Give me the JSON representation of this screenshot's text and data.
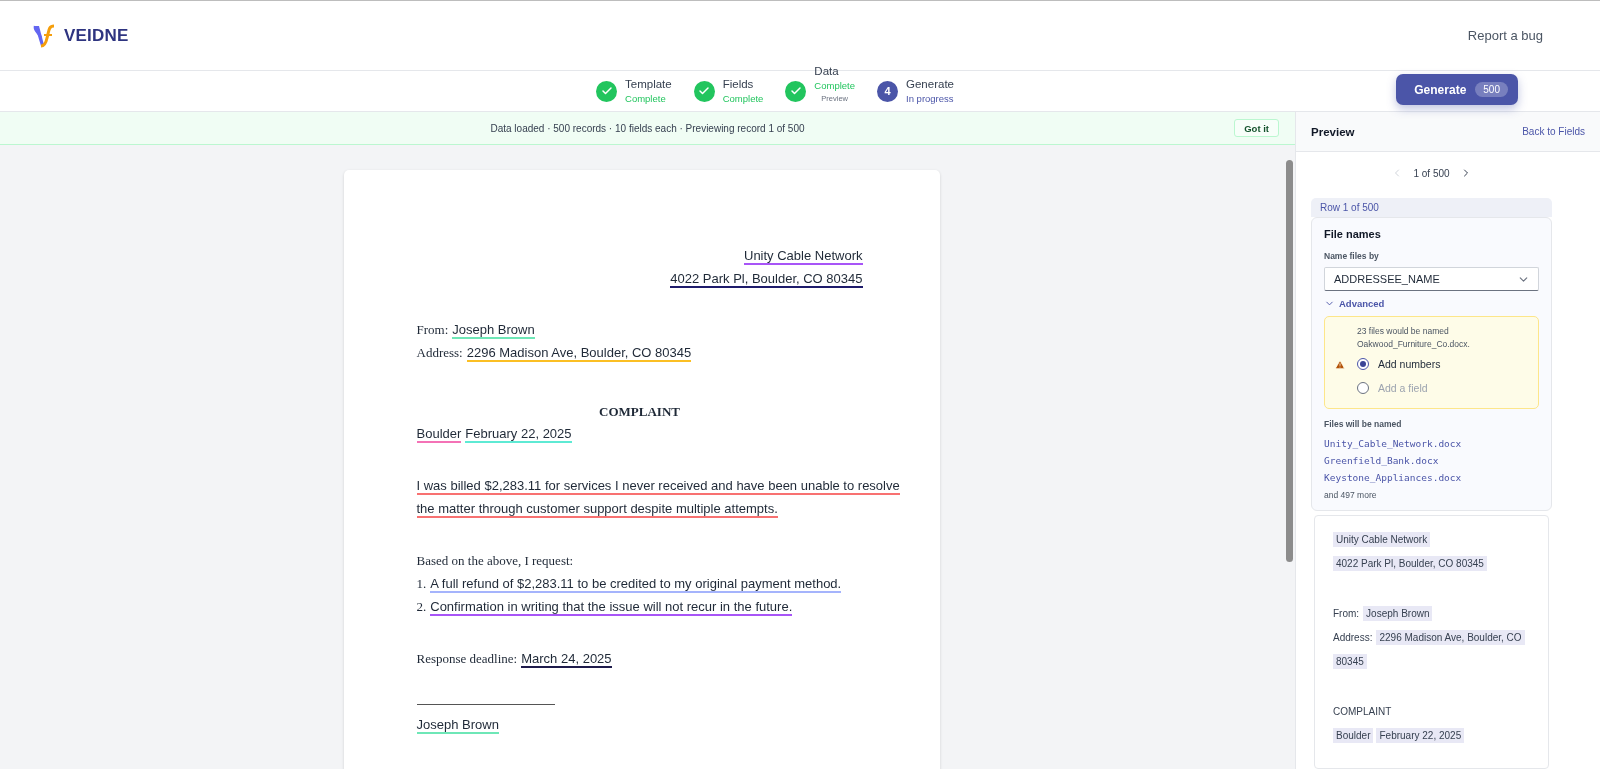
{
  "brand": {
    "name": "VEIDNE"
  },
  "header_link": "Report a bug",
  "steps": [
    {
      "label": "Template",
      "status": "Complete",
      "completed": true
    },
    {
      "label": "Fields",
      "status": "Complete",
      "completed": true
    },
    {
      "label": "Data",
      "status": "Complete",
      "completed": true,
      "note": "Preview"
    },
    {
      "label": "Generate",
      "status": "In progress",
      "completed": false,
      "number": "4"
    }
  ],
  "generate_button": {
    "label": "Generate",
    "count": "500"
  },
  "banner": {
    "text": "Data loaded · 500 records · 10 fields each · Previewing record 1 of 500",
    "button": "Got it"
  },
  "document": {
    "blocks": [
      {
        "kind": "right",
        "segments": [
          {
            "kind": "field",
            "text": "Unity Cable Network",
            "color": "#a855f7"
          }
        ]
      },
      {
        "kind": "right",
        "segments": [
          {
            "kind": "field",
            "text": "4022 Park Pl, Boulder, CO 80345",
            "color": "#1e1b6b"
          }
        ]
      },
      {
        "kind": "line",
        "space_before": true,
        "segments": [
          {
            "kind": "text",
            "text": "From:"
          },
          {
            "kind": "field",
            "text": "Joseph Brown",
            "color": "#6ee7b7"
          }
        ]
      },
      {
        "kind": "line",
        "segments": [
          {
            "kind": "text",
            "text": "Address:"
          },
          {
            "kind": "field",
            "text": "2296 Madison Ave, Boulder, CO 80345",
            "color": "#fbbf24"
          }
        ]
      },
      {
        "kind": "heading",
        "space_before": true,
        "segments": [
          {
            "kind": "text",
            "text": "COMPLAINT"
          }
        ]
      },
      {
        "kind": "line",
        "segments": [
          {
            "kind": "field",
            "text": "Boulder",
            "color": "#f472b6"
          },
          {
            "kind": "field",
            "text": "February 22, 2025",
            "color": "#5eead4"
          }
        ]
      },
      {
        "kind": "line",
        "space_before": true,
        "segments": [
          {
            "kind": "field",
            "text": "I was billed $2,283.11 for services I never received and have been unable to resolve",
            "color": "#f87171"
          }
        ]
      },
      {
        "kind": "line",
        "segments": [
          {
            "kind": "field",
            "text": "the matter through customer support despite multiple attempts.",
            "color": "#f87171"
          }
        ]
      },
      {
        "kind": "line",
        "space_before": true,
        "segments": [
          {
            "kind": "text",
            "text": "Based on the above, I request:"
          }
        ]
      },
      {
        "kind": "line",
        "segments": [
          {
            "kind": "text",
            "text": "1."
          },
          {
            "kind": "field",
            "text": "A full refund of $2,283.11 to be credited to my original payment method.",
            "color": "#a5b4fc"
          }
        ]
      },
      {
        "kind": "line",
        "segments": [
          {
            "kind": "text",
            "text": "2."
          },
          {
            "kind": "field",
            "text": "Confirmation in writing that the issue will not recur in the future.",
            "color": "#a855f7"
          }
        ]
      },
      {
        "kind": "line",
        "space_before": true,
        "segments": [
          {
            "kind": "text",
            "text": "Response deadline:"
          },
          {
            "kind": "field",
            "text": "March 24, 2025",
            "color": "#1e1b4b"
          }
        ]
      },
      {
        "kind": "rule",
        "space_before": true
      },
      {
        "kind": "line",
        "segments": [
          {
            "kind": "field",
            "text": "Joseph Brown",
            "color": "#6ee7b7"
          }
        ]
      }
    ]
  },
  "preview_panel": {
    "title": "Preview",
    "back_link": "Back to Fields",
    "pager": {
      "text": "1 of 500",
      "prev_disabled": true,
      "next_disabled": false
    },
    "row_label": "Row 1 of 500",
    "file_names": {
      "title": "File names",
      "select_label": "Name files by",
      "select_value": "ADDRESSEE_NAME",
      "advanced": {
        "label": "Advanced",
        "expanded": true
      },
      "warning": "23 files would be named Oakwood_Furniture_Co.docx.",
      "options": [
        {
          "label": "Add numbers",
          "selected": true
        },
        {
          "label": "Add a field",
          "selected": false
        }
      ],
      "list_label": "Files will be named",
      "files": [
        "Unity_Cable_Network.docx",
        "Greenfield_Bank.docx",
        "Keystone_Appliances.docx"
      ],
      "more": "and 497 more"
    },
    "mini_document": {
      "blocks": [
        {
          "segments": [
            {
              "kind": "field",
              "text": "Unity Cable Network"
            }
          ]
        },
        {
          "segments": [
            {
              "kind": "field",
              "text": "4022 Park Pl, Boulder, CO 80345"
            }
          ]
        },
        {
          "space_before": true,
          "segments": [
            {
              "kind": "text",
              "text": "From:"
            },
            {
              "kind": "field",
              "text": "Joseph Brown"
            }
          ]
        },
        {
          "segments": [
            {
              "kind": "text",
              "text": "Address:"
            },
            {
              "kind": "field",
              "text": "2296 Madison Ave, Boulder, CO"
            }
          ]
        },
        {
          "segments": [
            {
              "kind": "field",
              "text": "80345"
            }
          ]
        },
        {
          "space_before": true,
          "segments": [
            {
              "kind": "text",
              "text": "COMPLAINT"
            }
          ]
        },
        {
          "segments": [
            {
              "kind": "field",
              "text": "Boulder"
            },
            {
              "kind": "field",
              "text": "February 22, 2025"
            }
          ]
        }
      ]
    }
  }
}
